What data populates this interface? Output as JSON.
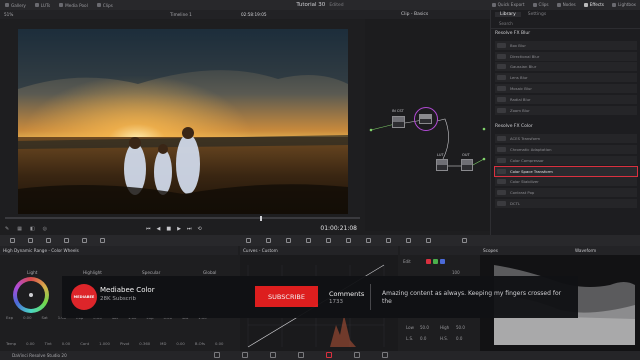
{
  "project": {
    "title": "Tutorial 30",
    "state": "Edited"
  },
  "topbar": {
    "left_items": [
      "Gallery",
      "LUTs",
      "Media Pool",
      "Clips"
    ],
    "right_items": [
      "Quick Export",
      "Clips",
      "Nodes",
      "Effects",
      "Lightbox"
    ],
    "active_item": "Effects"
  },
  "viewer": {
    "zoom": "51%",
    "timeline": "Timeline 1",
    "timecode_top": "02:58:19:05",
    "timecode": "01:00:21:08"
  },
  "nodes": {
    "title": "Clip - Basics",
    "labels": [
      "IN CST",
      "LUT",
      "OUT"
    ],
    "numbers": [
      "01",
      "02",
      "03",
      "04"
    ]
  },
  "library": {
    "tabs": [
      "Library",
      "Settings"
    ],
    "search_placeholder": "Search",
    "sections": [
      {
        "title": "Resolve FX Blur",
        "items": [
          "Box Blur",
          "Directional Blur",
          "Gaussian Blur",
          "Lens Blur",
          "Mosaic Blur",
          "Radial Blur",
          "Zoom Blur"
        ]
      },
      {
        "title": "Resolve FX Color",
        "items": [
          "ACES Transform",
          "Chromatic Adaptation",
          "Color Compressor",
          "Color Space Transform",
          "Color Stabilizer",
          "Contrast Pop",
          "DCTL"
        ]
      }
    ],
    "selected": "Color Space Transform"
  },
  "panels": {
    "wheels_title": "High Dynamic Range - Color Wheels",
    "wheel_labels": [
      "Light",
      "Highlight",
      "Specular",
      "Global"
    ],
    "curves_title": "Curves - Custom",
    "scopes_title": "Scopes",
    "scope_type": "Waveform",
    "edit_label": "Edit",
    "edit_value": "100",
    "qualifier": [
      "Low",
      "50.0",
      "High",
      "50.0",
      "L.S.",
      "0.0",
      "H.S.",
      "0.0"
    ]
  },
  "params": {
    "row1": [
      "Exp",
      "0.00",
      "Sat",
      "1.00",
      "Exp",
      "0.00",
      "Sat",
      "1.00",
      "Exp",
      "0.00",
      "Sat",
      "1.00",
      "Exp",
      "0.00",
      "Sat",
      "1.00"
    ],
    "row2": [
      "Temp",
      "0.00",
      "Tint",
      "0.00",
      "Cont",
      "1.000",
      "Pivot",
      "0.360",
      "MD",
      "0.00",
      "B.Ofs",
      "0.00"
    ]
  },
  "status": {
    "app": "DaVinci Resolve Studio 20"
  },
  "ad": {
    "logo_text": "MEDIABEE",
    "channel": "Mediabee Color",
    "subscribers": "28K Subscrib",
    "button": "SUBSCRIBE",
    "comments_label": "Comments",
    "comments_count": "1733",
    "comment": "Amazing content as always. Keeping my fingers crossed for the"
  },
  "colors": {
    "accent": "#d9303f",
    "subscribe": "#e81f1f",
    "node_selected": "#b14ad4"
  }
}
